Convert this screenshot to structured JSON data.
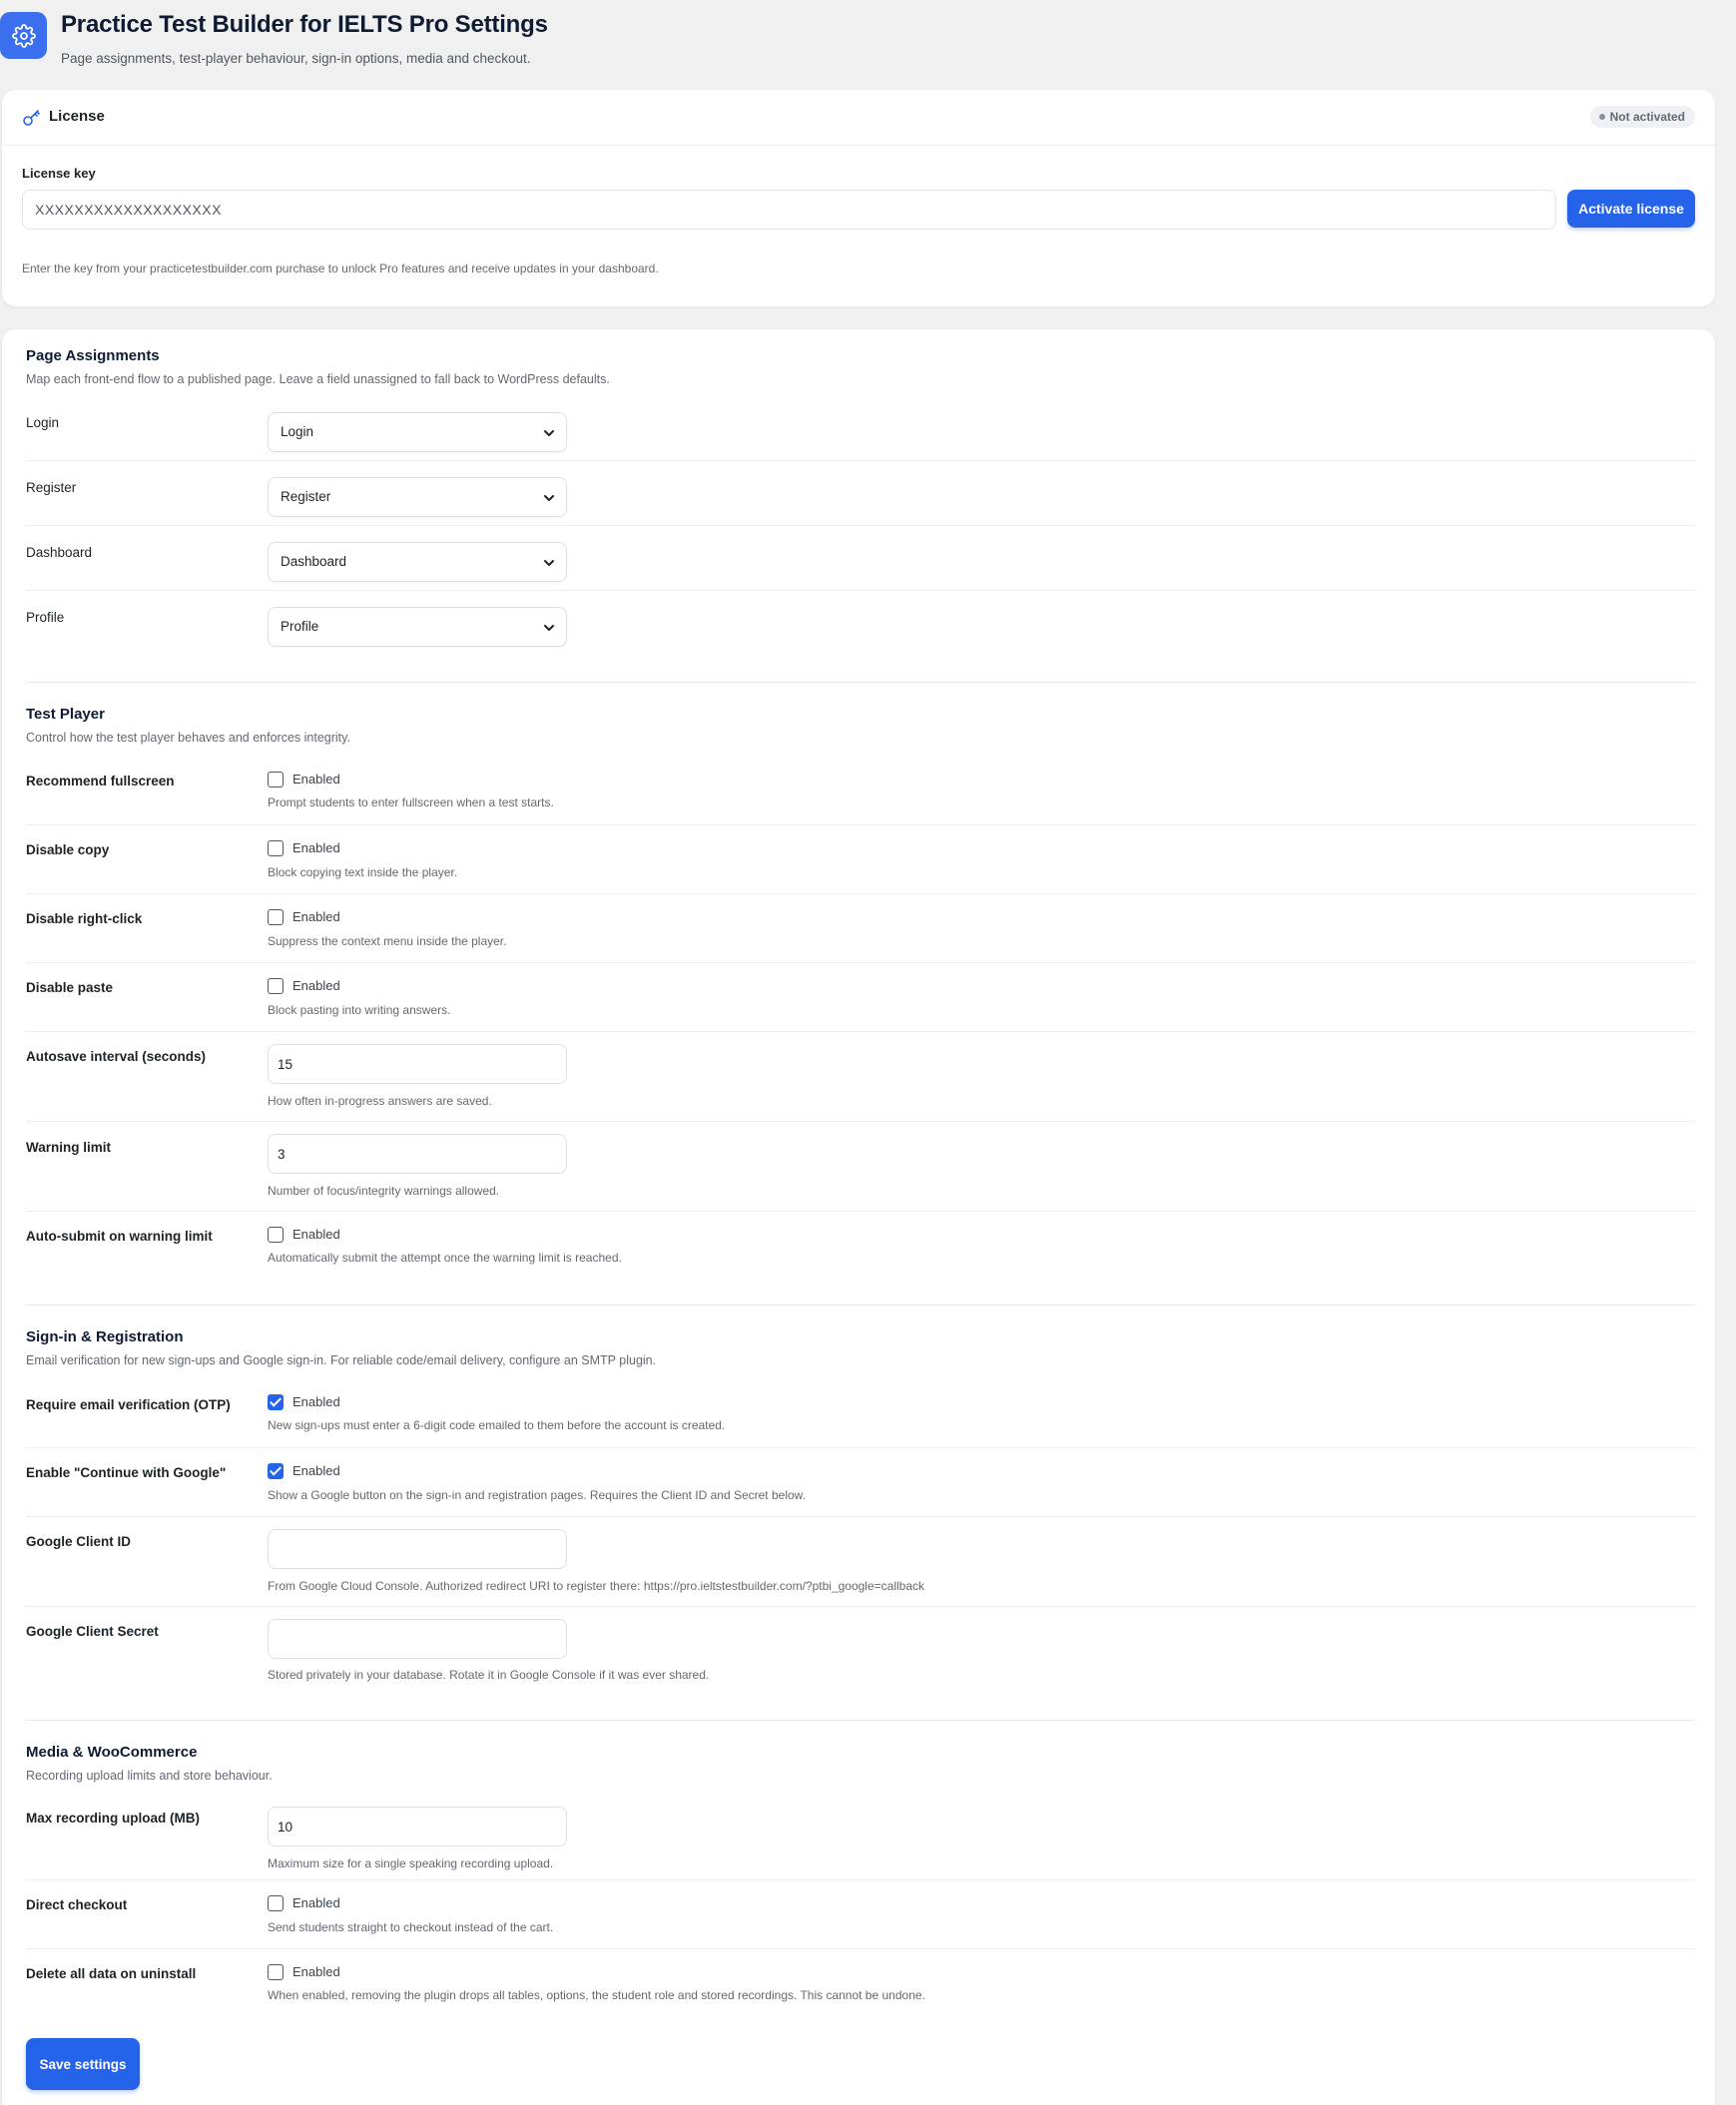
{
  "header": {
    "title": "Practice Test Builder for IELTS Pro Settings",
    "subtitle": "Page assignments, test-player behaviour, sign-in options, media and checkout.",
    "icon": "gear-icon"
  },
  "license": {
    "title": "License",
    "status_badge": "Not activated",
    "key_label": "License key",
    "key_value": "XXXXXXXXXXXXXXXXXXX",
    "activate_label": "Activate license",
    "help": "Enter the key from your practicetestbuilder.com purchase to unlock Pro features and receive updates in your dashboard."
  },
  "page_assignments": {
    "title": "Page Assignments",
    "description": "Map each front-end flow to a published page. Leave a field unassigned to fall back to WordPress defaults.",
    "rows": [
      {
        "label": "Login",
        "value": "Login"
      },
      {
        "label": "Register",
        "value": "Register"
      },
      {
        "label": "Dashboard",
        "value": "Dashboard"
      },
      {
        "label": "Profile",
        "value": "Profile"
      }
    ]
  },
  "test_player": {
    "title": "Test Player",
    "description": "Control how the test player behaves and enforces integrity.",
    "recommend_fullscreen": {
      "label": "Recommend fullscreen",
      "checkbox": "Enabled",
      "checked": false,
      "help": "Prompt students to enter fullscreen when a test starts."
    },
    "disable_copy": {
      "label": "Disable copy",
      "checkbox": "Enabled",
      "checked": false,
      "help": "Block copying text inside the player."
    },
    "disable_right_click": {
      "label": "Disable right-click",
      "checkbox": "Enabled",
      "checked": false,
      "help": "Suppress the context menu inside the player."
    },
    "disable_paste": {
      "label": "Disable paste",
      "checkbox": "Enabled",
      "checked": false,
      "help": "Block pasting into writing answers."
    },
    "autosave_interval": {
      "label": "Autosave interval (seconds)",
      "value": "15",
      "help": "How often in-progress answers are saved."
    },
    "warning_limit": {
      "label": "Warning limit",
      "value": "3",
      "help": "Number of focus/integrity warnings allowed."
    },
    "auto_submit": {
      "label": "Auto-submit on warning limit",
      "checkbox": "Enabled",
      "checked": false,
      "help": "Automatically submit the attempt once the warning limit is reached."
    }
  },
  "signin": {
    "title": "Sign-in & Registration",
    "description": "Email verification for new sign-ups and Google sign-in. For reliable code/email delivery, configure an SMTP plugin.",
    "require_otp": {
      "label": "Require email verification (OTP)",
      "checkbox": "Enabled",
      "checked": true,
      "help": "New sign-ups must enter a 6-digit code emailed to them before the account is created."
    },
    "google_enable": {
      "label": "Enable \"Continue with Google\"",
      "checkbox": "Enabled",
      "checked": true,
      "help": "Show a Google button on the sign-in and registration pages. Requires the Client ID and Secret below."
    },
    "client_id": {
      "label": "Google Client ID",
      "value": "",
      "help": "From Google Cloud Console. Authorized redirect URI to register there: https://pro.ieltstestbuilder.com/?ptbi_google=callback"
    },
    "client_secret": {
      "label": "Google Client Secret",
      "value": "",
      "help": "Stored privately in your database. Rotate it in Google Console if it was ever shared."
    }
  },
  "media": {
    "title": "Media & WooCommerce",
    "description": "Recording upload limits and store behaviour.",
    "max_upload": {
      "label": "Max recording upload (MB)",
      "value": "10",
      "help": "Maximum size for a single speaking recording upload."
    },
    "direct_checkout": {
      "label": "Direct checkout",
      "checkbox": "Enabled",
      "checked": false,
      "help": "Send students straight to checkout instead of the cart."
    },
    "delete_data": {
      "label": "Delete all data on uninstall",
      "checkbox": "Enabled",
      "checked": false,
      "help": "When enabled, removing the plugin drops all tables, options, the student role and stored recordings. This cannot be undone."
    }
  },
  "save_label": "Save settings",
  "colors": {
    "accent": "#2563eb",
    "background": "#f0f0f1",
    "card": "#ffffff"
  }
}
